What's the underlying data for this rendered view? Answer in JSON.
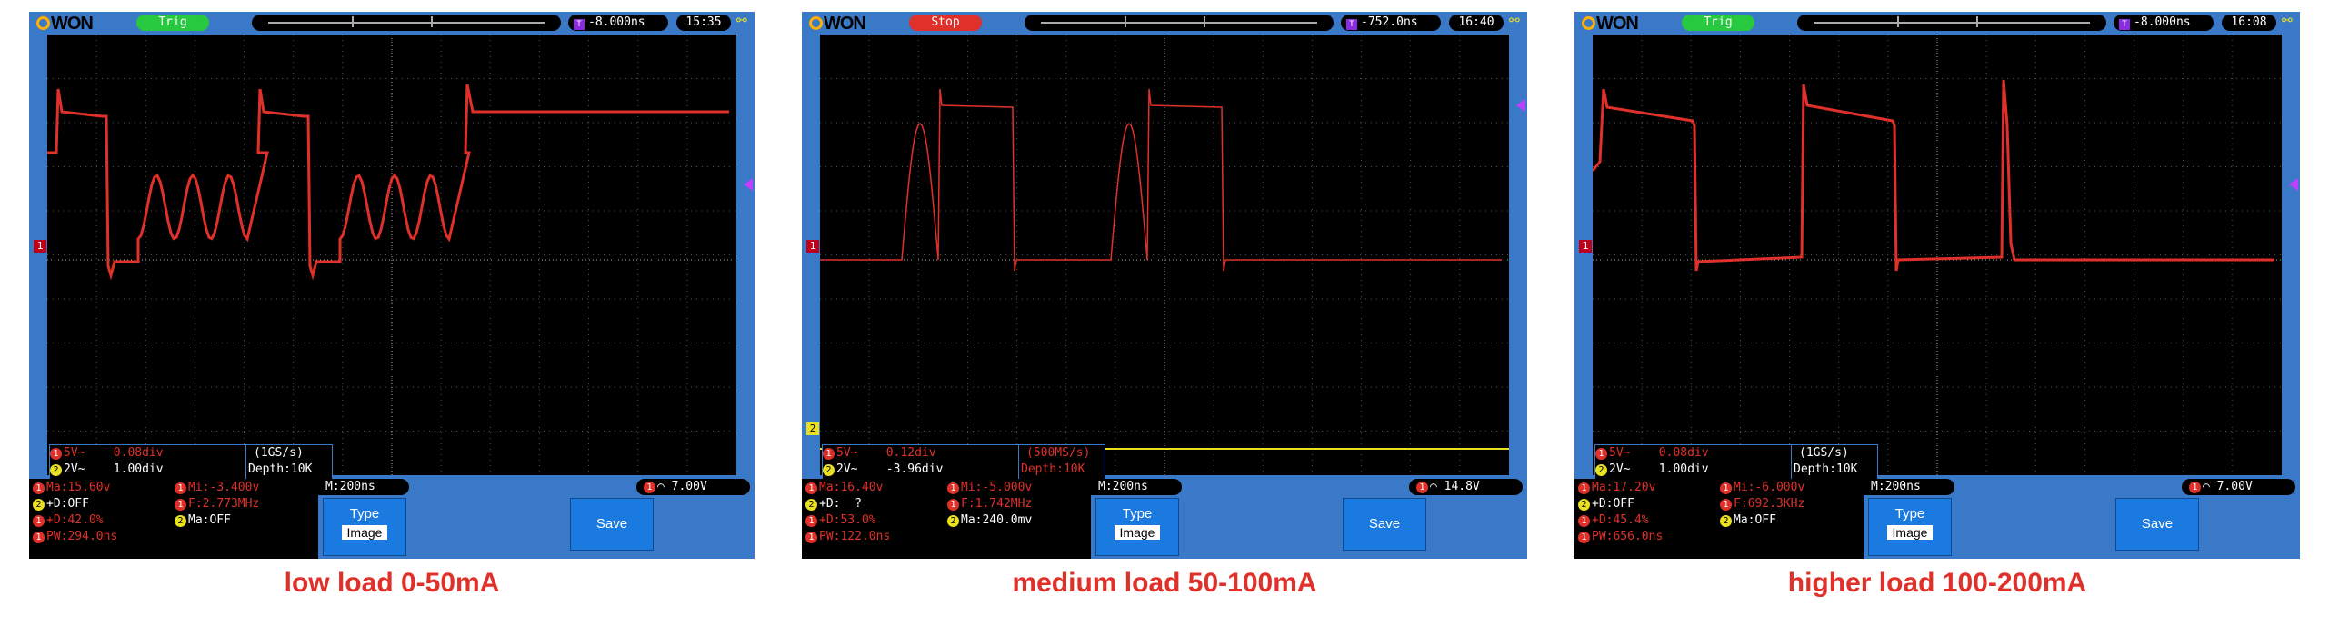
{
  "panels": [
    {
      "brand_logo": "OWON",
      "trigger_status": "Trig",
      "trigger_offset": "-8.000ns",
      "clock": "15:35",
      "ch1_label": "5V~",
      "ch1_offset": "0.08div",
      "ch2_label": "2V~",
      "ch2_offset": "1.00div",
      "sample_rate": "(1GS/s)",
      "depth": "Depth:10K",
      "ma1": "Ma:15.60v",
      "mi1": "Mi:-3.400v",
      "d2": "+D:OFF",
      "f1": "F:2.773MHz",
      "duty1": "+D:42.0%",
      "ma2": "Ma:OFF",
      "pw1": "PW:294.0ns",
      "timebase": "M:200ns",
      "trigger_level": "7.00V",
      "type_label": "Type",
      "type_value": "Image",
      "save_label": "Save",
      "caption": "low load 0-50mA"
    },
    {
      "brand_logo": "OWON",
      "trigger_status": "Stop",
      "trigger_offset": "-752.0ns",
      "clock": "16:40",
      "ch1_label": "5V~",
      "ch1_offset": "0.12div",
      "ch2_label": "2V~",
      "ch2_offset": "-3.96div",
      "sample_rate": "(500MS/s)",
      "depth": "Depth:10K",
      "ma1": "Ma:16.40v",
      "mi1": "Mi:-5.000v",
      "d2": "+D:  ?",
      "f1": "F:1.742MHz",
      "duty1": "+D:53.0%",
      "ma2": "Ma:240.0mv",
      "pw1": "PW:122.0ns",
      "timebase": "M:200ns",
      "trigger_level": "14.8V",
      "type_label": "Type",
      "type_value": "Image",
      "save_label": "Save",
      "caption": "medium load 50-100mA"
    },
    {
      "brand_logo": "OWON",
      "trigger_status": "Trig",
      "trigger_offset": "-8.000ns",
      "clock": "16:08",
      "ch1_label": "5V~",
      "ch1_offset": "0.08div",
      "ch2_label": "2V~",
      "ch2_offset": "1.00div",
      "sample_rate": "(1GS/s)",
      "depth": "Depth:10K",
      "ma1": "Ma:17.20v",
      "mi1": "Mi:-6.000v",
      "d2": "+D:OFF",
      "f1": "F:692.3KHz",
      "duty1": "+D:45.4%",
      "ma2": "Ma:OFF",
      "pw1": "PW:656.0ns",
      "timebase": "M:200ns",
      "trigger_level": "7.00V",
      "type_label": "Type",
      "type_value": "Image",
      "save_label": "Save",
      "caption": "higher load 100-200mA"
    }
  ],
  "colors": {
    "frame": "#3a78c8",
    "ch1": "#e0302a",
    "ch2": "#e8e020",
    "trig_run": "#27c93f",
    "trig_stop": "#e0302a",
    "caption": "#e0302a"
  },
  "icons": {
    "trigger_marker": "t-marker-icon",
    "usb": "usb-icon",
    "edge": "rising-edge-icon"
  }
}
